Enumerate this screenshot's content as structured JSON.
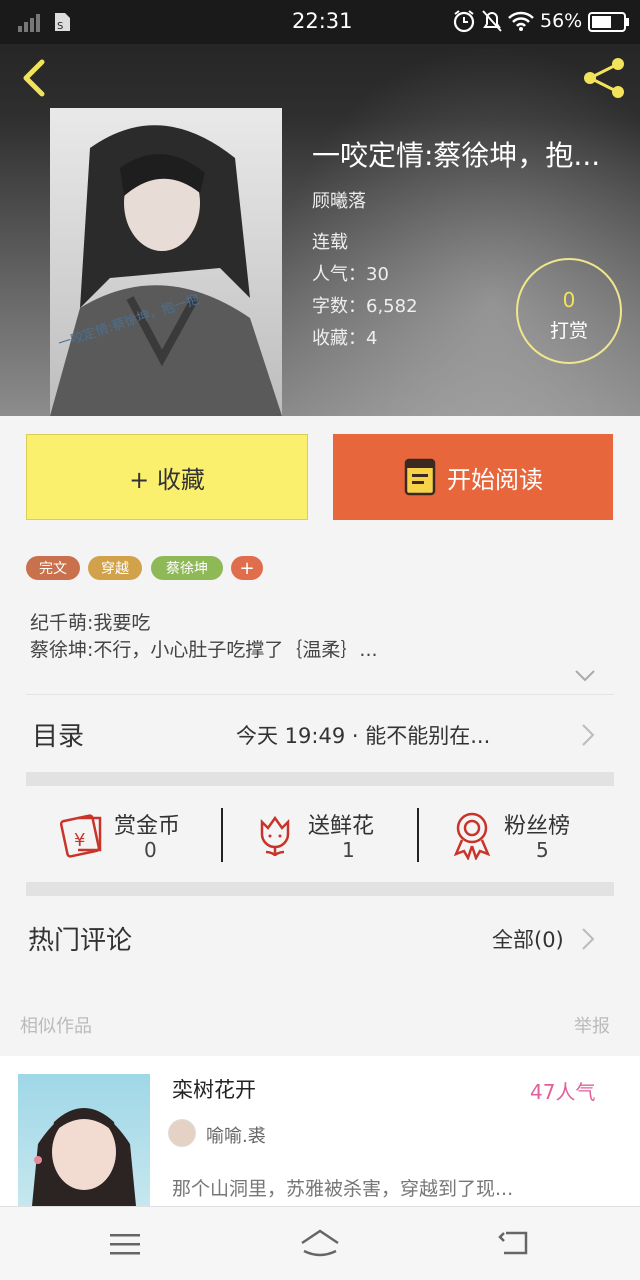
{
  "status_bar": {
    "time": "22:31",
    "battery": "56%"
  },
  "book": {
    "title": "一咬定情:蔡徐坤，抱...",
    "author": "顾曦落",
    "status": "连载",
    "popularity": "人气：30",
    "word_count": "字数：6,582",
    "favorites": "收藏：4",
    "cover_caption": "一咬定情:蔡徐坤，抱一抱",
    "reward_count": "0",
    "reward_label": "打赏"
  },
  "actions": {
    "favorite": "+ 收藏",
    "start_reading": "开始阅读"
  },
  "tags": [
    "完文",
    "穿越",
    "蔡徐坤",
    "+"
  ],
  "colors": {
    "tag1": "#c9704d",
    "tag2": "#d2a24a",
    "tag3": "#8fb857",
    "tag4": "#e06d4b",
    "read_btn": "#e8663c",
    "fav_btn": "#fbf06e",
    "accent_red": "#c8342a",
    "popularity_pink": "#e0609b"
  },
  "summary": {
    "line1": "纪千萌:我要吃",
    "line2": "蔡徐坤:不行，小心肚子吃撑了｛温柔｝..."
  },
  "catalog": {
    "label": "目录",
    "latest": "今天 19:49 · 能不能别在..."
  },
  "stats": [
    {
      "label": "赏金币",
      "value": "0",
      "icon": "red-envelope-icon"
    },
    {
      "label": "送鲜花",
      "value": "1",
      "icon": "flower-icon"
    },
    {
      "label": "粉丝榜",
      "value": "5",
      "icon": "medal-icon"
    }
  ],
  "comments": {
    "label": "热门评论",
    "all": "全部(0)"
  },
  "similar": {
    "label": "相似作品",
    "report": "举报"
  },
  "related": {
    "title": "栾树花开",
    "author": "喻喻.裘",
    "popularity": "47人气",
    "excerpt": "那个山洞里，苏雅被杀害，穿越到了现..."
  }
}
